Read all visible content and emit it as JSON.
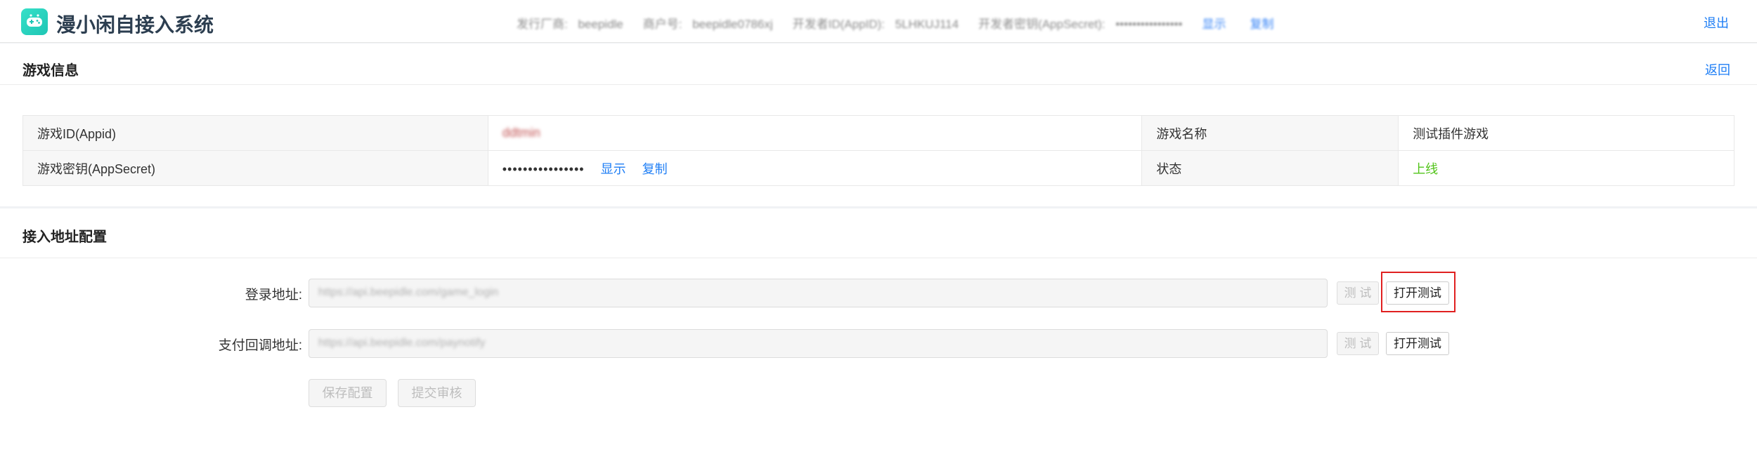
{
  "header": {
    "app_title": "漫小闲自接入系统",
    "logo_icon": "gamepad-icon",
    "account": {
      "developer_label": "发行厂商:",
      "developer_value": "beepidle",
      "merchant_label": "商户号:",
      "merchant_value": "beepidle0786xj",
      "appid_label": "开发者ID(AppID):",
      "appid_value": "5LHKUJ114",
      "secret_label": "开发者密钥(AppSecret):",
      "secret_value": "••••••••••••••••",
      "show_label": "显示",
      "copy_label": "复制"
    },
    "logout_label": "退出"
  },
  "game_info": {
    "title": "游戏信息",
    "back_label": "返回",
    "rows": [
      {
        "label1": "游戏ID(Appid)",
        "value1": "ddtmin",
        "label2": "游戏名称",
        "value2": "测试插件游戏"
      },
      {
        "label1": "游戏密钥(AppSecret)",
        "value1": "••••••••••••••••",
        "show_label": "显示",
        "copy_label": "复制",
        "label2": "状态",
        "value2": "上线"
      }
    ]
  },
  "access_config": {
    "title": "接入地址配置",
    "login": {
      "label": "登录地址:",
      "value": "https://api.beepidle.com/game_login",
      "test_label": "测 试",
      "open_test_label": "打开测试"
    },
    "pay": {
      "label": "支付回调地址:",
      "value": "https://api.beepidle.com/paynotify",
      "test_label": "测 试",
      "open_test_label": "打开测试"
    },
    "save_label": "保存配置",
    "submit_label": "提交审核"
  },
  "colors": {
    "accent": "#1e7ef5",
    "online": "#52c41a",
    "highlight": "#e02020",
    "logo": "#1fc6b5"
  }
}
